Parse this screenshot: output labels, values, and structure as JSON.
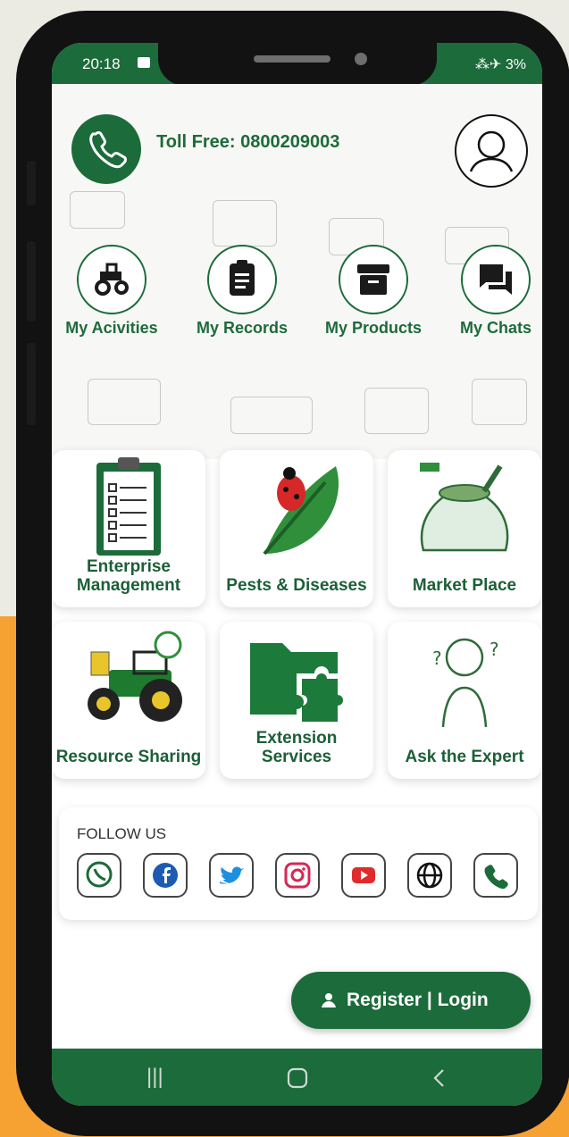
{
  "status": {
    "time": "20:18",
    "right": "⁂✈ 3%"
  },
  "header": {
    "toll_free": "Toll Free: 0800209003"
  },
  "quick_links": [
    {
      "label": "My Acivities",
      "icon": "tractor-icon"
    },
    {
      "label": "My Records",
      "icon": "clipboard-icon"
    },
    {
      "label": "My Products",
      "icon": "archive-box-icon"
    },
    {
      "label": "My Chats",
      "icon": "chat-icon"
    }
  ],
  "cards": [
    {
      "title": "Enterprise Management",
      "icon": "checklist-clipboard-icon"
    },
    {
      "title": "Pests & Diseases",
      "icon": "ladybug-leaf-icon"
    },
    {
      "title": "Market Place",
      "icon": "produce-sack-icon"
    },
    {
      "title": "Resource Sharing",
      "icon": "tractor-sprayer-icon"
    },
    {
      "title": "Extension Services",
      "icon": "folder-puzzle-icon"
    },
    {
      "title": "Ask the Expert",
      "icon": "thinking-person-icon"
    }
  ],
  "follow": {
    "title": "FOLLOW US",
    "icons": [
      "whatsapp-icon",
      "facebook-icon",
      "twitter-icon",
      "instagram-icon",
      "youtube-icon",
      "globe-icon",
      "phone-icon"
    ]
  },
  "register": {
    "label": "Register | Login"
  },
  "colors": {
    "primary": "#1c6b3a",
    "accent_bg": "#f5a233"
  }
}
